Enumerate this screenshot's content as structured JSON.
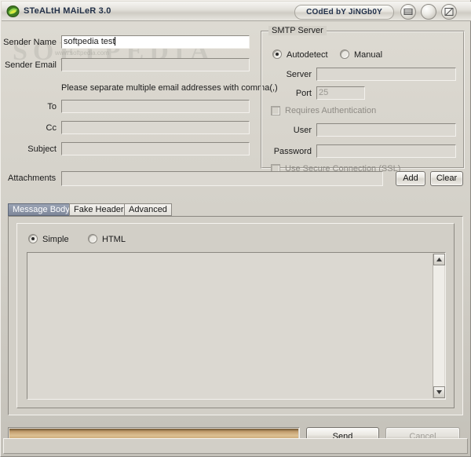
{
  "window": {
    "title": "STeALtH MAiLeR 3.0",
    "coder_credit": "COdEd bY JiNGb0Y",
    "app_icon": "mail-app-icon",
    "buttons": {
      "minimize": "minimize-button",
      "maximize": "maximize-button",
      "close": "close-button"
    }
  },
  "watermark": {
    "text": "SOFTPEDIA",
    "small": "www.softpedia.com"
  },
  "compose": {
    "sender_name_label": "Sender Name",
    "sender_name_value": "softpedia test",
    "sender_email_label": "Sender Email",
    "sender_email_value": "",
    "hint": "Please separate multiple email addresses with comma(,)",
    "to_label": "To",
    "to_value": "",
    "cc_label": "Cc",
    "cc_value": "",
    "subject_label": "Subject",
    "subject_value": "",
    "attachments_label": "Attachments",
    "attachments_value": "",
    "add_label": "Add",
    "clear_label": "Clear"
  },
  "smtp": {
    "group_title": "SMTP Server",
    "mode_autodetect": "Autodetect",
    "mode_manual": "Manual",
    "mode_selected": "Autodetect",
    "server_label": "Server",
    "server_value": "",
    "port_label": "Port",
    "port_value": "25",
    "requires_auth_label": "Requires Authentication",
    "requires_auth_checked": false,
    "user_label": "User",
    "user_value": "",
    "password_label": "Password",
    "password_value": "",
    "ssl_label": "Use Secure Connection (SSL)",
    "ssl_checked": false
  },
  "tabs": [
    {
      "label": "Message Body",
      "active": true
    },
    {
      "label": "Fake Headers",
      "active": false
    },
    {
      "label": "Advanced",
      "active": false
    }
  ],
  "message_body": {
    "format_simple": "Simple",
    "format_html": "HTML",
    "format_selected": "Simple",
    "body_value": ""
  },
  "footer": {
    "progress_percent": 100,
    "send_label": "Send",
    "cancel_label": "Cancel",
    "cancel_enabled": false,
    "status_text": ""
  },
  "colors": {
    "face": "#d2cfc7",
    "title_text": "#223048",
    "tab_active_bg": "#8a93a6",
    "progress_fill": "#c9a76f"
  }
}
